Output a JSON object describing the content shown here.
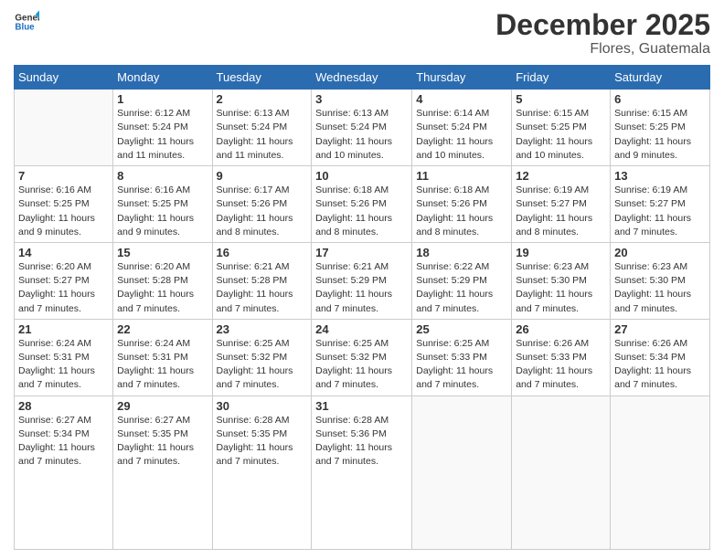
{
  "header": {
    "logo_line1": "General",
    "logo_line2": "Blue",
    "title": "December 2025",
    "subtitle": "Flores, Guatemala"
  },
  "days_of_week": [
    "Sunday",
    "Monday",
    "Tuesday",
    "Wednesday",
    "Thursday",
    "Friday",
    "Saturday"
  ],
  "weeks": [
    [
      {
        "day": "",
        "info": ""
      },
      {
        "day": "1",
        "info": "Sunrise: 6:12 AM\nSunset: 5:24 PM\nDaylight: 11 hours\nand 11 minutes."
      },
      {
        "day": "2",
        "info": "Sunrise: 6:13 AM\nSunset: 5:24 PM\nDaylight: 11 hours\nand 11 minutes."
      },
      {
        "day": "3",
        "info": "Sunrise: 6:13 AM\nSunset: 5:24 PM\nDaylight: 11 hours\nand 10 minutes."
      },
      {
        "day": "4",
        "info": "Sunrise: 6:14 AM\nSunset: 5:24 PM\nDaylight: 11 hours\nand 10 minutes."
      },
      {
        "day": "5",
        "info": "Sunrise: 6:15 AM\nSunset: 5:25 PM\nDaylight: 11 hours\nand 10 minutes."
      },
      {
        "day": "6",
        "info": "Sunrise: 6:15 AM\nSunset: 5:25 PM\nDaylight: 11 hours\nand 9 minutes."
      }
    ],
    [
      {
        "day": "7",
        "info": "Sunrise: 6:16 AM\nSunset: 5:25 PM\nDaylight: 11 hours\nand 9 minutes."
      },
      {
        "day": "8",
        "info": "Sunrise: 6:16 AM\nSunset: 5:25 PM\nDaylight: 11 hours\nand 9 minutes."
      },
      {
        "day": "9",
        "info": "Sunrise: 6:17 AM\nSunset: 5:26 PM\nDaylight: 11 hours\nand 8 minutes."
      },
      {
        "day": "10",
        "info": "Sunrise: 6:18 AM\nSunset: 5:26 PM\nDaylight: 11 hours\nand 8 minutes."
      },
      {
        "day": "11",
        "info": "Sunrise: 6:18 AM\nSunset: 5:26 PM\nDaylight: 11 hours\nand 8 minutes."
      },
      {
        "day": "12",
        "info": "Sunrise: 6:19 AM\nSunset: 5:27 PM\nDaylight: 11 hours\nand 8 minutes."
      },
      {
        "day": "13",
        "info": "Sunrise: 6:19 AM\nSunset: 5:27 PM\nDaylight: 11 hours\nand 7 minutes."
      }
    ],
    [
      {
        "day": "14",
        "info": "Sunrise: 6:20 AM\nSunset: 5:27 PM\nDaylight: 11 hours\nand 7 minutes."
      },
      {
        "day": "15",
        "info": "Sunrise: 6:20 AM\nSunset: 5:28 PM\nDaylight: 11 hours\nand 7 minutes."
      },
      {
        "day": "16",
        "info": "Sunrise: 6:21 AM\nSunset: 5:28 PM\nDaylight: 11 hours\nand 7 minutes."
      },
      {
        "day": "17",
        "info": "Sunrise: 6:21 AM\nSunset: 5:29 PM\nDaylight: 11 hours\nand 7 minutes."
      },
      {
        "day": "18",
        "info": "Sunrise: 6:22 AM\nSunset: 5:29 PM\nDaylight: 11 hours\nand 7 minutes."
      },
      {
        "day": "19",
        "info": "Sunrise: 6:23 AM\nSunset: 5:30 PM\nDaylight: 11 hours\nand 7 minutes."
      },
      {
        "day": "20",
        "info": "Sunrise: 6:23 AM\nSunset: 5:30 PM\nDaylight: 11 hours\nand 7 minutes."
      }
    ],
    [
      {
        "day": "21",
        "info": "Sunrise: 6:24 AM\nSunset: 5:31 PM\nDaylight: 11 hours\nand 7 minutes."
      },
      {
        "day": "22",
        "info": "Sunrise: 6:24 AM\nSunset: 5:31 PM\nDaylight: 11 hours\nand 7 minutes."
      },
      {
        "day": "23",
        "info": "Sunrise: 6:25 AM\nSunset: 5:32 PM\nDaylight: 11 hours\nand 7 minutes."
      },
      {
        "day": "24",
        "info": "Sunrise: 6:25 AM\nSunset: 5:32 PM\nDaylight: 11 hours\nand 7 minutes."
      },
      {
        "day": "25",
        "info": "Sunrise: 6:25 AM\nSunset: 5:33 PM\nDaylight: 11 hours\nand 7 minutes."
      },
      {
        "day": "26",
        "info": "Sunrise: 6:26 AM\nSunset: 5:33 PM\nDaylight: 11 hours\nand 7 minutes."
      },
      {
        "day": "27",
        "info": "Sunrise: 6:26 AM\nSunset: 5:34 PM\nDaylight: 11 hours\nand 7 minutes."
      }
    ],
    [
      {
        "day": "28",
        "info": "Sunrise: 6:27 AM\nSunset: 5:34 PM\nDaylight: 11 hours\nand 7 minutes."
      },
      {
        "day": "29",
        "info": "Sunrise: 6:27 AM\nSunset: 5:35 PM\nDaylight: 11 hours\nand 7 minutes."
      },
      {
        "day": "30",
        "info": "Sunrise: 6:28 AM\nSunset: 5:35 PM\nDaylight: 11 hours\nand 7 minutes."
      },
      {
        "day": "31",
        "info": "Sunrise: 6:28 AM\nSunset: 5:36 PM\nDaylight: 11 hours\nand 7 minutes."
      },
      {
        "day": "",
        "info": ""
      },
      {
        "day": "",
        "info": ""
      },
      {
        "day": "",
        "info": ""
      }
    ]
  ]
}
